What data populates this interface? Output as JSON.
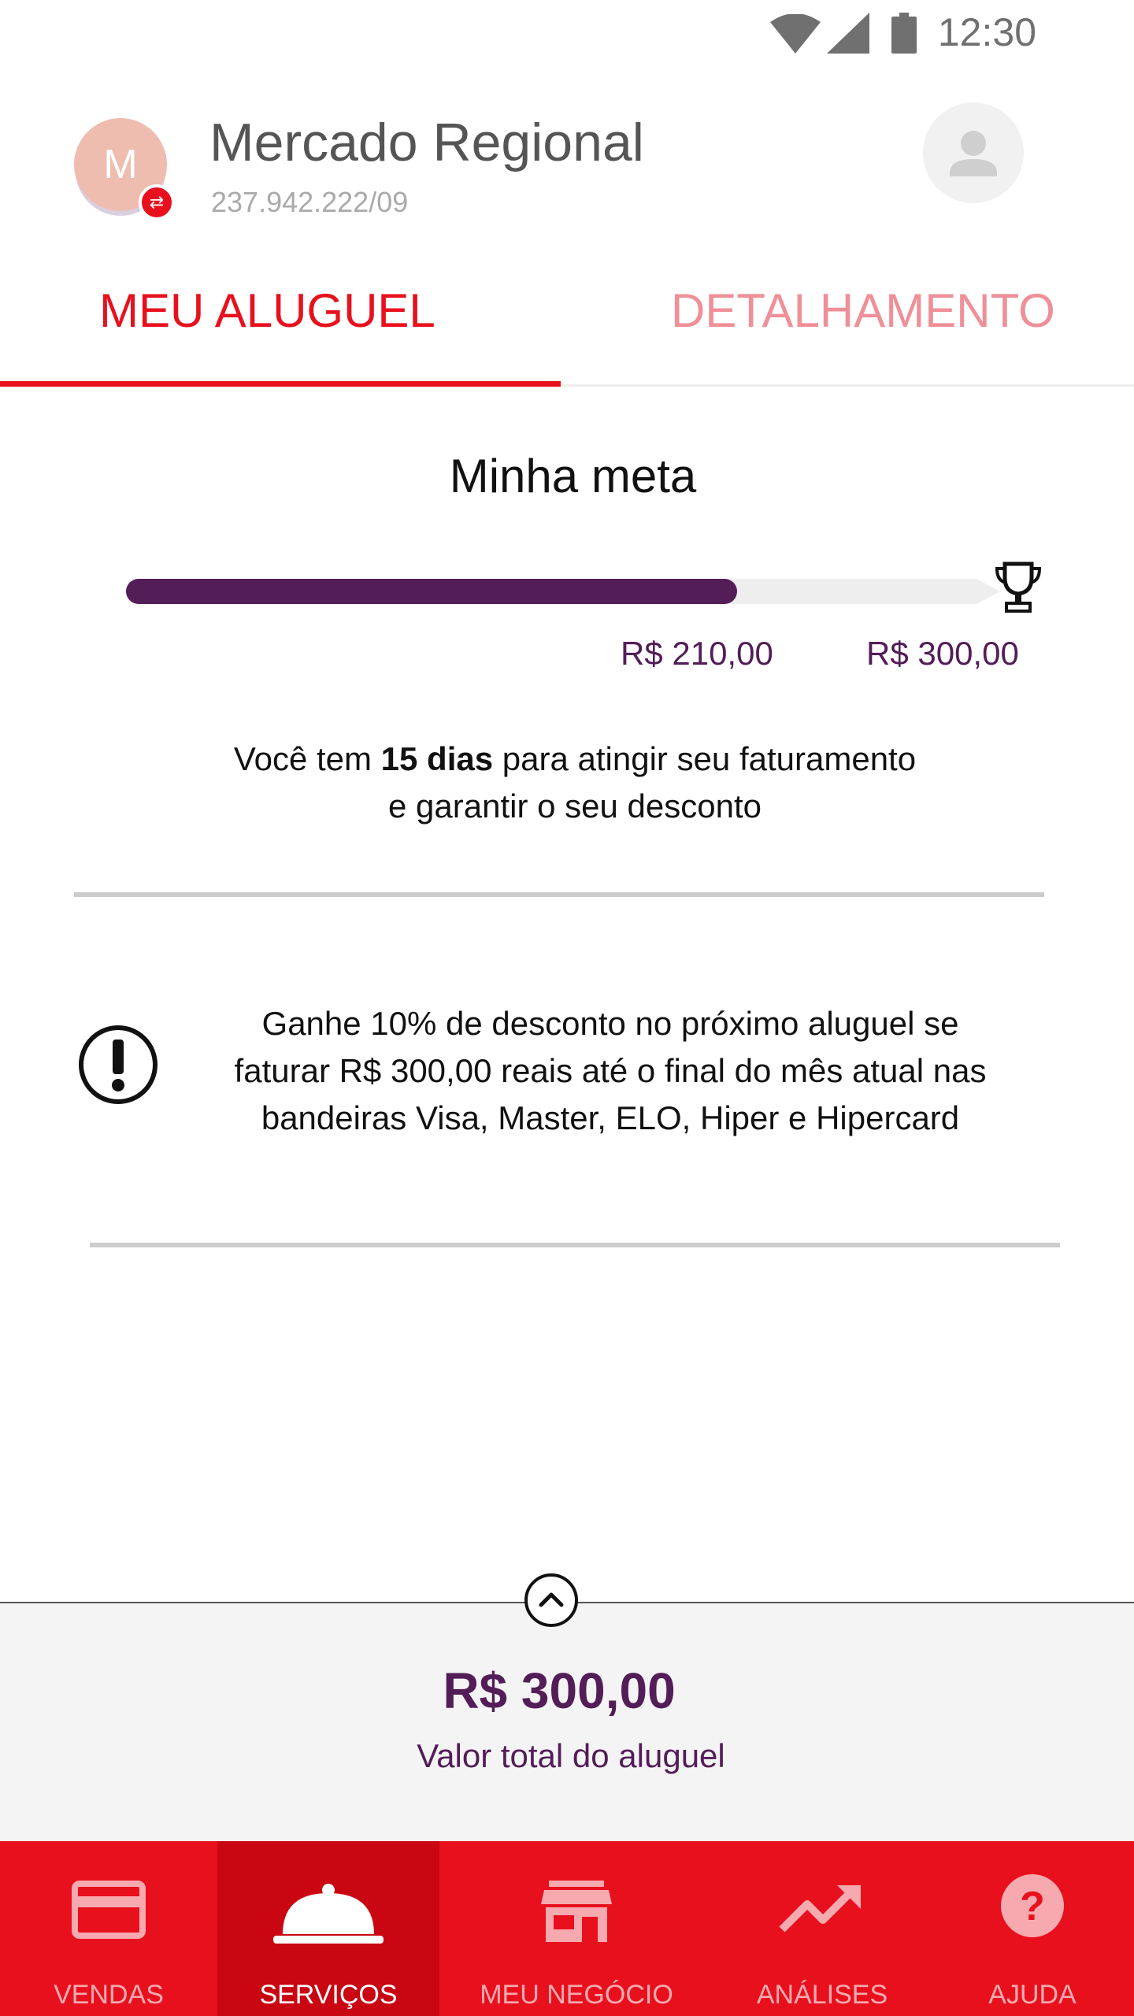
{
  "status_bar": {
    "time": "12:30",
    "icons": [
      "wifi-icon",
      "signal-icon",
      "battery-icon"
    ]
  },
  "header": {
    "avatar_initial": "M",
    "merchant_name": "Mercado Regional",
    "merchant_document": "237.942.222/09",
    "profile_icon": "user-icon"
  },
  "tabs": [
    {
      "label": "MEU ALUGUEL",
      "active": true
    },
    {
      "label": "DETALHAMENTO",
      "active": false
    }
  ],
  "goal": {
    "title": "Minha meta",
    "current_value": "R$ 210,00",
    "target_value": "R$ 300,00",
    "progress_fraction": 0.7,
    "message_prefix": "Você tem ",
    "message_bold": "15 dias",
    "message_suffix": " para atingir seu faturamento",
    "message_line2": "e garantir o seu desconto"
  },
  "discount": {
    "icon": "alert-icon",
    "line1": "Ganhe 10% de desconto no próximo aluguel se",
    "line2": "faturar R$ 300,00 reais até o final do mês atual nas",
    "line3": "bandeiras Visa, Master, ELO, Hiper e Hipercard"
  },
  "summary": {
    "total_value": "R$ 300,00",
    "total_label": "Valor total do aluguel"
  },
  "bottom_nav": [
    {
      "label": "VENDAS",
      "icon": "card-icon",
      "active": false
    },
    {
      "label": "SERVIÇOS",
      "icon": "cloche-icon",
      "active": true
    },
    {
      "label": "MEU NEGÓCIO",
      "icon": "store-icon",
      "active": false
    },
    {
      "label": "ANÁLISES",
      "icon": "trending-up-icon",
      "active": false
    },
    {
      "label": "AJUDA",
      "icon": "help-icon",
      "active": false
    }
  ],
  "colors": {
    "brand_red": "#e8101d",
    "brand_red_dark": "#c90611",
    "purple": "#531d58",
    "tab_inactive": "#ef8f98",
    "nav_inactive": "#f6aab0"
  }
}
